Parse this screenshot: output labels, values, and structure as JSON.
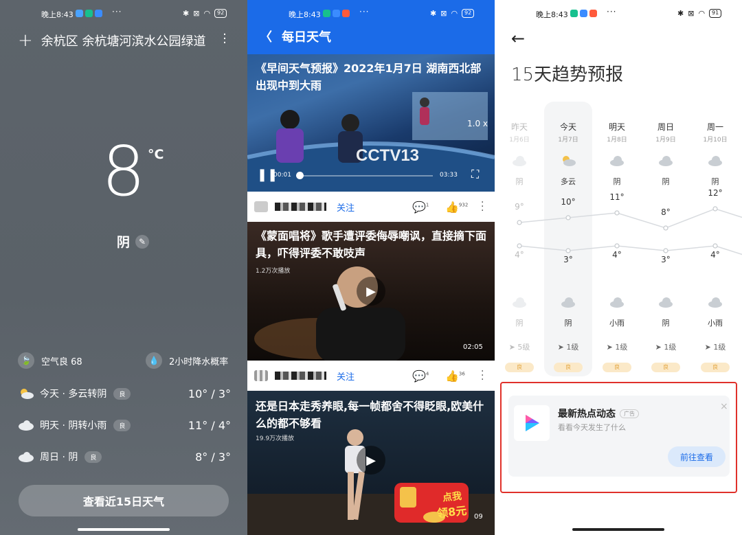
{
  "status_bar": {
    "time": "晚上8:43",
    "battery_1": "92",
    "battery_2": "92",
    "battery_3": "91"
  },
  "weather": {
    "location": "余杭区 余杭塘河滨水公园绿道",
    "temperature": "8",
    "unit": "°C",
    "condition": "阴",
    "air_quality": "空气良 68",
    "precip_label": "2小时降水概率",
    "forecast": [
      {
        "label": "今天 · 多云转阴",
        "aq": "良",
        "range": "10° / 3°"
      },
      {
        "label": "明天 · 阴转小雨",
        "aq": "良",
        "range": "11° / 4°"
      },
      {
        "label": "周日 · 阴",
        "aq": "良",
        "range": "8° / 3°"
      }
    ],
    "button_15d": "查看近15日天气"
  },
  "daily": {
    "title": "每日天气",
    "cards": [
      {
        "title": "《早间天气预报》2022年1月7日 湖南西北部出现中到大雨",
        "time_current": "00:01",
        "time_total": "03:33",
        "speed": "1.0 x",
        "logo": "CCTV13"
      },
      {
        "title": "《蒙面唱将》歌手遭评委侮辱嘲讽，直接摘下面具，吓得评委不敢吱声",
        "views": "1.2万次播放",
        "duration": "02:05"
      },
      {
        "title": "还是日本走秀养眼,每一帧都舍不得眨眼,欧美什么的都不够看",
        "views": "19.9万次播放",
        "duration": "09",
        "promo_line1": "点我",
        "promo_line2": "领8元"
      }
    ],
    "meta": [
      {
        "follow": "关注",
        "comments": "1",
        "likes": "932"
      },
      {
        "follow": "关注",
        "comments": "4",
        "likes": "36"
      }
    ]
  },
  "trend": {
    "title": "15天趋势预报",
    "days": [
      {
        "name": "昨天",
        "date": "1月6日",
        "day_cond": "阴",
        "high": "9°",
        "low": "4°",
        "night_cond": "阴",
        "wind": "5级",
        "aq": "良"
      },
      {
        "name": "今天",
        "date": "1月7日",
        "day_cond": "多云",
        "high": "10°",
        "low": "3°",
        "night_cond": "阴",
        "wind": "1级",
        "aq": "良"
      },
      {
        "name": "明天",
        "date": "1月8日",
        "day_cond": "阴",
        "high": "11°",
        "low": "4°",
        "night_cond": "小雨",
        "wind": "1级",
        "aq": "良"
      },
      {
        "name": "周日",
        "date": "1月9日",
        "day_cond": "阴",
        "high": "8°",
        "low": "3°",
        "night_cond": "阴",
        "wind": "1级",
        "aq": "良"
      },
      {
        "name": "周一",
        "date": "1月10日",
        "day_cond": "阴",
        "high": "12°",
        "low": "4°",
        "night_cond": "小雨",
        "wind": "1级",
        "aq": "良"
      }
    ],
    "ad": {
      "title": "最新热点动态",
      "tag": "广告",
      "subtitle": "看看今天发生了什么",
      "button": "前往查看",
      "close": "×"
    }
  }
}
